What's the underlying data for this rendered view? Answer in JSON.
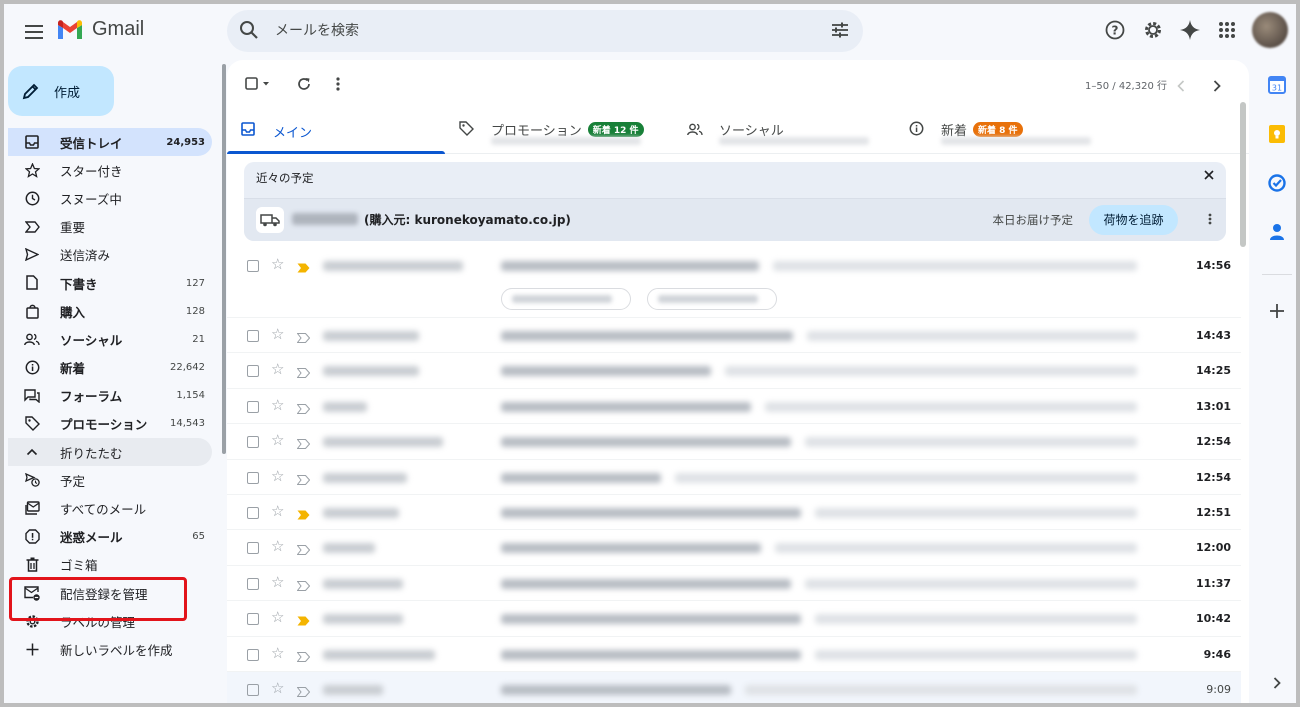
{
  "app": {
    "name": "Gmail",
    "colors": {
      "accent": "#0b57d0",
      "compose": "#c2e7ff",
      "active_nav": "#d3e3fd",
      "highlight_box": "#e2141b",
      "badge_green": "#188038",
      "badge_orange": "#e8710a"
    }
  },
  "search": {
    "placeholder": "メールを検索"
  },
  "compose": {
    "label": "作成"
  },
  "sidebar": {
    "items": [
      {
        "label": "受信トレイ",
        "count": "24,953",
        "icon": "inbox-icon",
        "bold": true,
        "active": true
      },
      {
        "label": "スター付き",
        "count": "",
        "icon": "star-icon"
      },
      {
        "label": "スヌーズ中",
        "count": "",
        "icon": "clock-icon"
      },
      {
        "label": "重要",
        "count": "",
        "icon": "important-icon"
      },
      {
        "label": "送信済み",
        "count": "",
        "icon": "send-icon"
      },
      {
        "label": "下書き",
        "count": "127",
        "icon": "draft-icon",
        "bold": true
      },
      {
        "label": "購入",
        "count": "128",
        "icon": "shopping-bag-icon",
        "bold": true
      },
      {
        "label": "ソーシャル",
        "count": "21",
        "icon": "people-icon",
        "bold": true
      },
      {
        "label": "新着",
        "count": "22,642",
        "icon": "info-icon",
        "bold": true
      },
      {
        "label": "フォーラム",
        "count": "1,154",
        "icon": "forum-icon",
        "bold": true
      },
      {
        "label": "プロモーション",
        "count": "14,543",
        "icon": "tag-icon",
        "bold": true
      },
      {
        "label": "折りたたむ",
        "count": "",
        "icon": "chevron-up-icon",
        "collapse": true
      },
      {
        "label": "予定",
        "count": "",
        "icon": "scheduled-icon"
      },
      {
        "label": "すべてのメール",
        "count": "",
        "icon": "all-mail-icon"
      },
      {
        "label": "迷惑メール",
        "count": "65",
        "icon": "spam-icon",
        "bold": true
      },
      {
        "label": "ゴミ箱",
        "count": "",
        "icon": "trash-icon"
      },
      {
        "label": "配信登録を管理",
        "count": "",
        "icon": "manage-subscriptions-icon"
      },
      {
        "label": "ラベルの管理",
        "count": "",
        "icon": "gear-icon"
      },
      {
        "label": "新しいラベルを作成",
        "count": "",
        "icon": "plus-icon"
      }
    ]
  },
  "toolbar": {
    "pager": "1–50 / 42,320 行"
  },
  "tabs": [
    {
      "label": "メイン",
      "icon": "inbox-icon",
      "badge": "",
      "active": true
    },
    {
      "label": "プロモーション",
      "icon": "tag-icon",
      "badge": "新着 12 件",
      "badge_color": "green"
    },
    {
      "label": "ソーシャル",
      "icon": "people-icon",
      "badge": ""
    },
    {
      "label": "新着",
      "icon": "info-icon",
      "badge": "新着 8 件",
      "badge_color": "orange"
    }
  ],
  "upcoming": {
    "title": "近々の予定",
    "sender": "(購入元: kuronekoyamato.co.jp)",
    "status": "本日お届け予定",
    "action": "荷物を追跡"
  },
  "mails": [
    {
      "time": "14:56",
      "important": true,
      "tall": true,
      "bold": true
    },
    {
      "time": "14:43",
      "important": false,
      "bold": true
    },
    {
      "time": "14:25",
      "important": false,
      "bold": true
    },
    {
      "time": "13:01",
      "important": false,
      "bold": true
    },
    {
      "time": "12:54",
      "important": false,
      "bold": true
    },
    {
      "time": "12:54",
      "important": false,
      "bold": true
    },
    {
      "time": "12:51",
      "important": true,
      "bold": true
    },
    {
      "time": "12:00",
      "important": false,
      "bold": true
    },
    {
      "time": "11:37",
      "important": false,
      "bold": true
    },
    {
      "time": "10:42",
      "important": true,
      "bold": true
    },
    {
      "time": "9:46",
      "important": false,
      "bold": true
    },
    {
      "time": "9:09",
      "important": false,
      "bold": false,
      "read": true
    }
  ]
}
